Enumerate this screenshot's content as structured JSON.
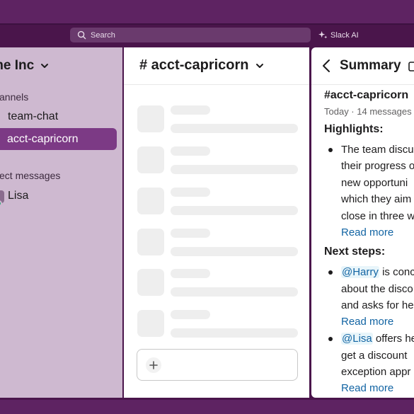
{
  "topbar": {
    "search_placeholder": "Search",
    "ai_label": "Slack AI",
    "search_icon": "search-icon",
    "ai_icon": "sparkle-icon"
  },
  "sidebar": {
    "workspace_name": "me Inc",
    "channels_header": "annels",
    "channels": [
      "team-chat",
      "acct-capricorn"
    ],
    "active_channel": "acct-capricorn",
    "dm_header": "ect messages",
    "dms": [
      {
        "name": "Lisa",
        "status": "online"
      }
    ]
  },
  "channel": {
    "title": "# acct-capricorn",
    "skeleton_rows": 6,
    "composer_icon": "plus-icon"
  },
  "summary": {
    "title": "Summary",
    "channel": "#acct-capricorn",
    "meta": "Today · 14 messages",
    "highlights_heading": "Highlights:",
    "highlights": [
      {
        "lines": [
          "The team discu",
          "their progress o",
          "new opportuni",
          "which they aim",
          "close in three w"
        ],
        "link": "Read more"
      }
    ],
    "next_steps_heading": "Next steps:",
    "next_steps": [
      {
        "mention": "@Harry",
        "lines": [
          " is conc",
          "about the disco",
          "and asks for he"
        ],
        "link": "Read more"
      },
      {
        "mention": "@Lisa",
        "lines": [
          " offers he",
          "get a discount",
          "exception appr"
        ],
        "link": "Read more"
      }
    ]
  },
  "colors": {
    "aubergine": "#4a154b",
    "sidebar_bg": "#ceb9d0",
    "active_item": "#7c3a85",
    "link": "#1264a3",
    "presence": "#2bac76"
  }
}
